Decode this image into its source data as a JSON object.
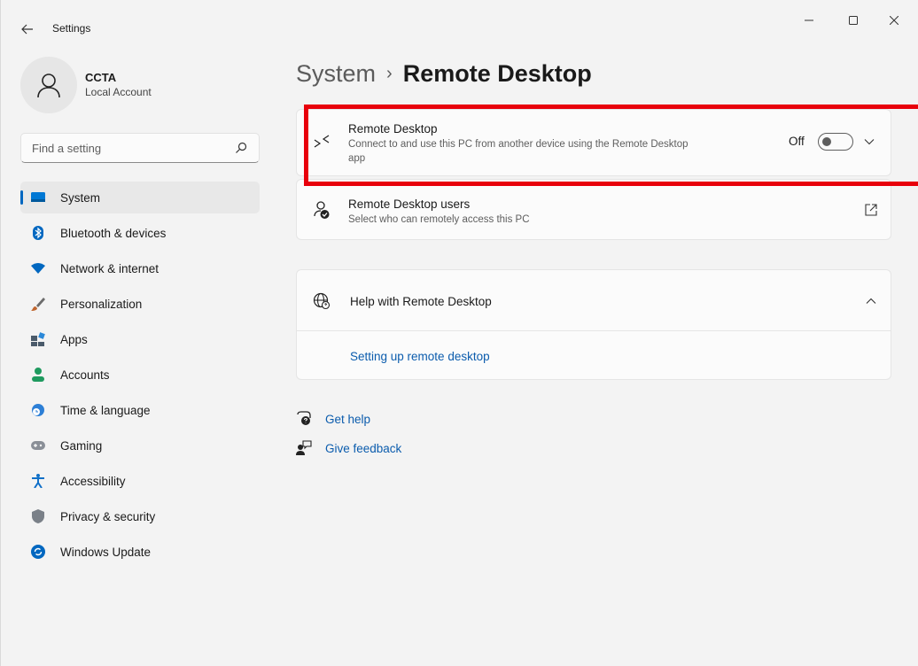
{
  "window": {
    "title": "Settings",
    "controls": [
      "minimize",
      "maximize",
      "close"
    ]
  },
  "profile": {
    "name": "CCTA",
    "account_type": "Local Account"
  },
  "search": {
    "placeholder": "Find a setting"
  },
  "sidebar": {
    "items": [
      {
        "label": "System",
        "icon": "system-icon",
        "active": true,
        "color": "#0078d4"
      },
      {
        "label": "Bluetooth & devices",
        "icon": "bluetooth-icon",
        "color": "#0067c0"
      },
      {
        "label": "Network & internet",
        "icon": "wifi-icon",
        "color": "#0067c0"
      },
      {
        "label": "Personalization",
        "icon": "brush-icon",
        "color": "#c0662f"
      },
      {
        "label": "Apps",
        "icon": "apps-icon",
        "color": "#4a5a6a"
      },
      {
        "label": "Accounts",
        "icon": "person-icon",
        "color": "#1f9a5f"
      },
      {
        "label": "Time & language",
        "icon": "globe-clock-icon",
        "color": "#2d7fd6"
      },
      {
        "label": "Gaming",
        "icon": "gamepad-icon",
        "color": "#8a8f97"
      },
      {
        "label": "Accessibility",
        "icon": "accessibility-icon",
        "color": "#1070c8"
      },
      {
        "label": "Privacy & security",
        "icon": "shield-icon",
        "color": "#7a8088"
      },
      {
        "label": "Windows Update",
        "icon": "update-icon",
        "color": "#0067c0"
      }
    ]
  },
  "breadcrumb": {
    "parent": "System",
    "separator": "›",
    "current": "Remote Desktop"
  },
  "remote_desktop": {
    "title": "Remote Desktop",
    "description": "Connect to and use this PC from another device using the Remote Desktop app",
    "toggle_state_label": "Off",
    "enabled": false
  },
  "remote_users": {
    "title": "Remote Desktop users",
    "description": "Select who can remotely access this PC"
  },
  "help": {
    "title": "Help with Remote Desktop",
    "link": "Setting up remote desktop"
  },
  "footer_links": {
    "get_help": "Get help",
    "give_feedback": "Give feedback"
  },
  "colors": {
    "accent": "#0067c0",
    "link": "#0b5cad",
    "highlight": "#e8000b",
    "background": "#f3f3f3",
    "card": "#fbfbfb"
  }
}
